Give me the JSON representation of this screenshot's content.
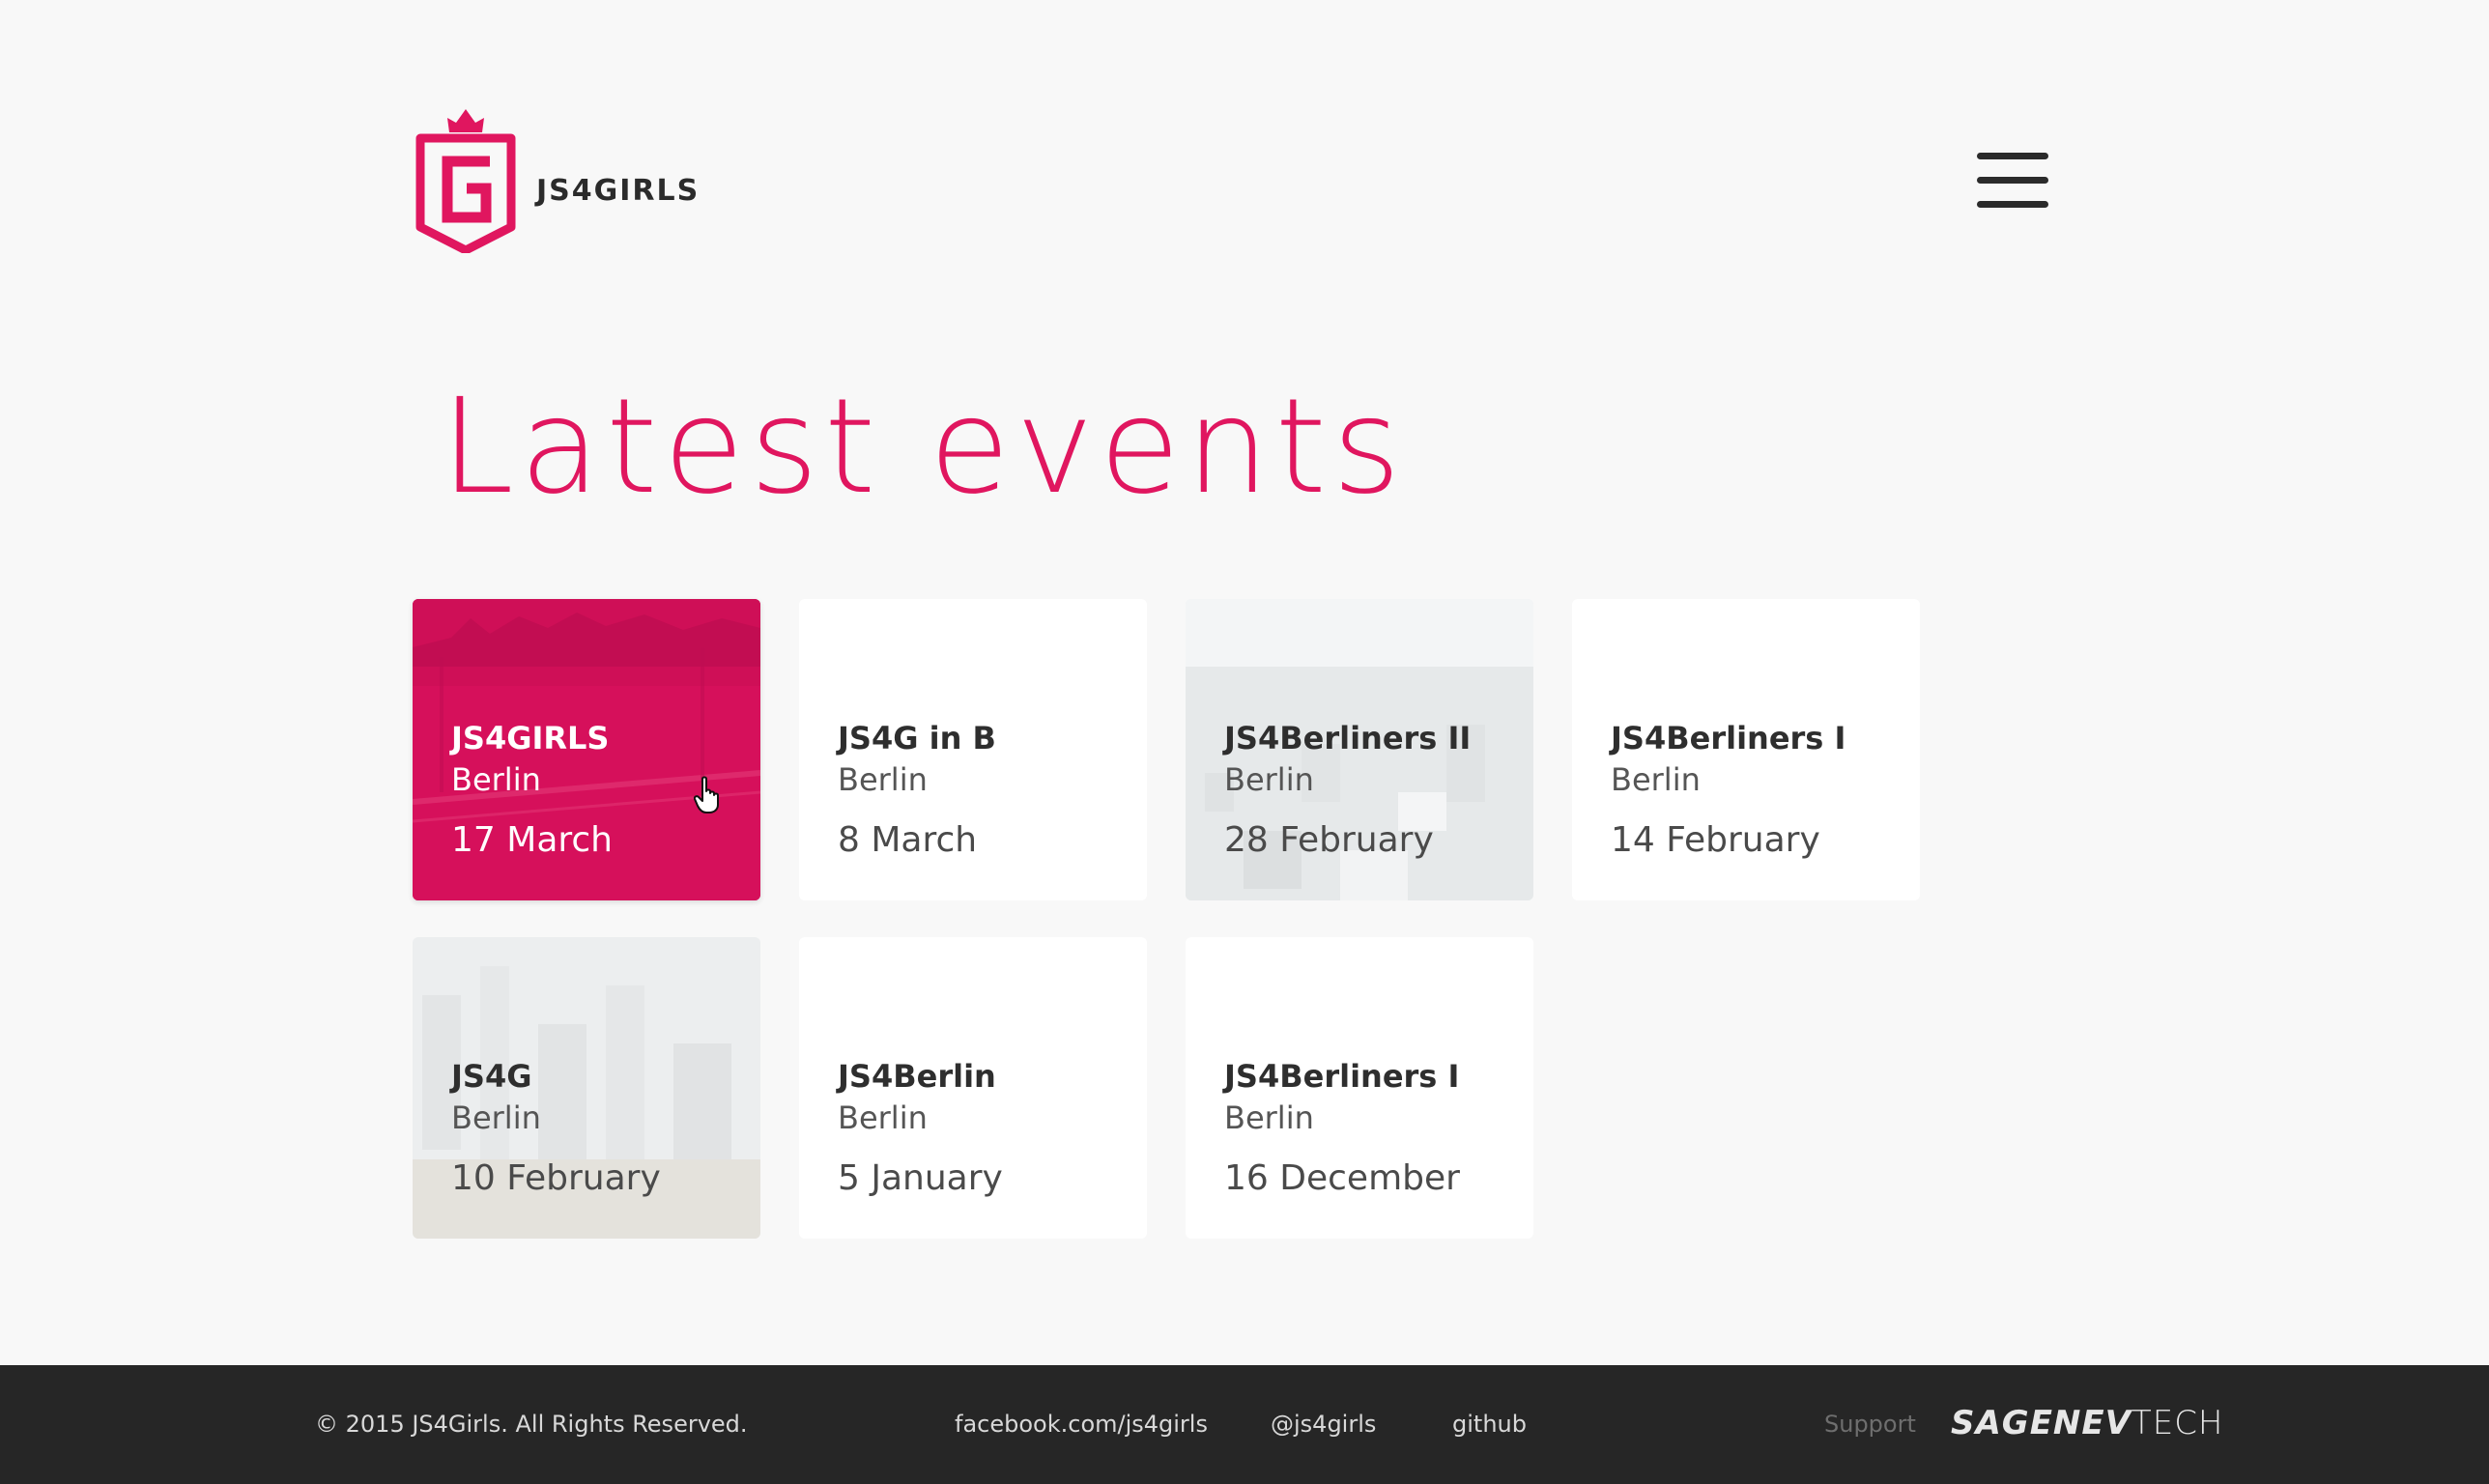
{
  "header": {
    "logo_text": "JS4GIRLS",
    "brand_color": "#e0165f"
  },
  "main": {
    "title": "Latest events",
    "events": [
      {
        "name": "JS4GIRLS",
        "city": "Berlin",
        "date": "17 March",
        "style": "highlighted"
      },
      {
        "name": "JS4G in B",
        "city": "Berlin",
        "date": "8 March",
        "style": "plain"
      },
      {
        "name": "JS4Berliners II",
        "city": "Berlin",
        "date": "28 February",
        "style": "photo"
      },
      {
        "name": "JS4Berliners I",
        "city": "Berlin",
        "date": "14 February",
        "style": "plain"
      },
      {
        "name": "JS4G",
        "city": "Berlin",
        "date": "10 February",
        "style": "photo"
      },
      {
        "name": "JS4Berlin",
        "city": "Berlin",
        "date": "5 January",
        "style": "plain"
      },
      {
        "name": "JS4Berliners I",
        "city": "Berlin",
        "date": "16 December",
        "style": "plain"
      }
    ]
  },
  "footer": {
    "copyright": "© 2015 JS4Girls. All Rights Reserved.",
    "links": {
      "facebook": "facebook.com/js4girls",
      "twitter": "@js4girls",
      "github": "github"
    },
    "support_label": "Support",
    "brand_bold": "SAGENEV",
    "brand_light": "TECH"
  },
  "icons": {
    "logo": "crown-shield-g-logo-icon",
    "menu": "hamburger-menu-icon",
    "cursor": "hand-pointer-cursor-icon"
  },
  "colors": {
    "accent": "#e0165f",
    "card_active": "#d6105b",
    "footer_bg": "#262626",
    "page_bg": "#f8f8f8"
  }
}
